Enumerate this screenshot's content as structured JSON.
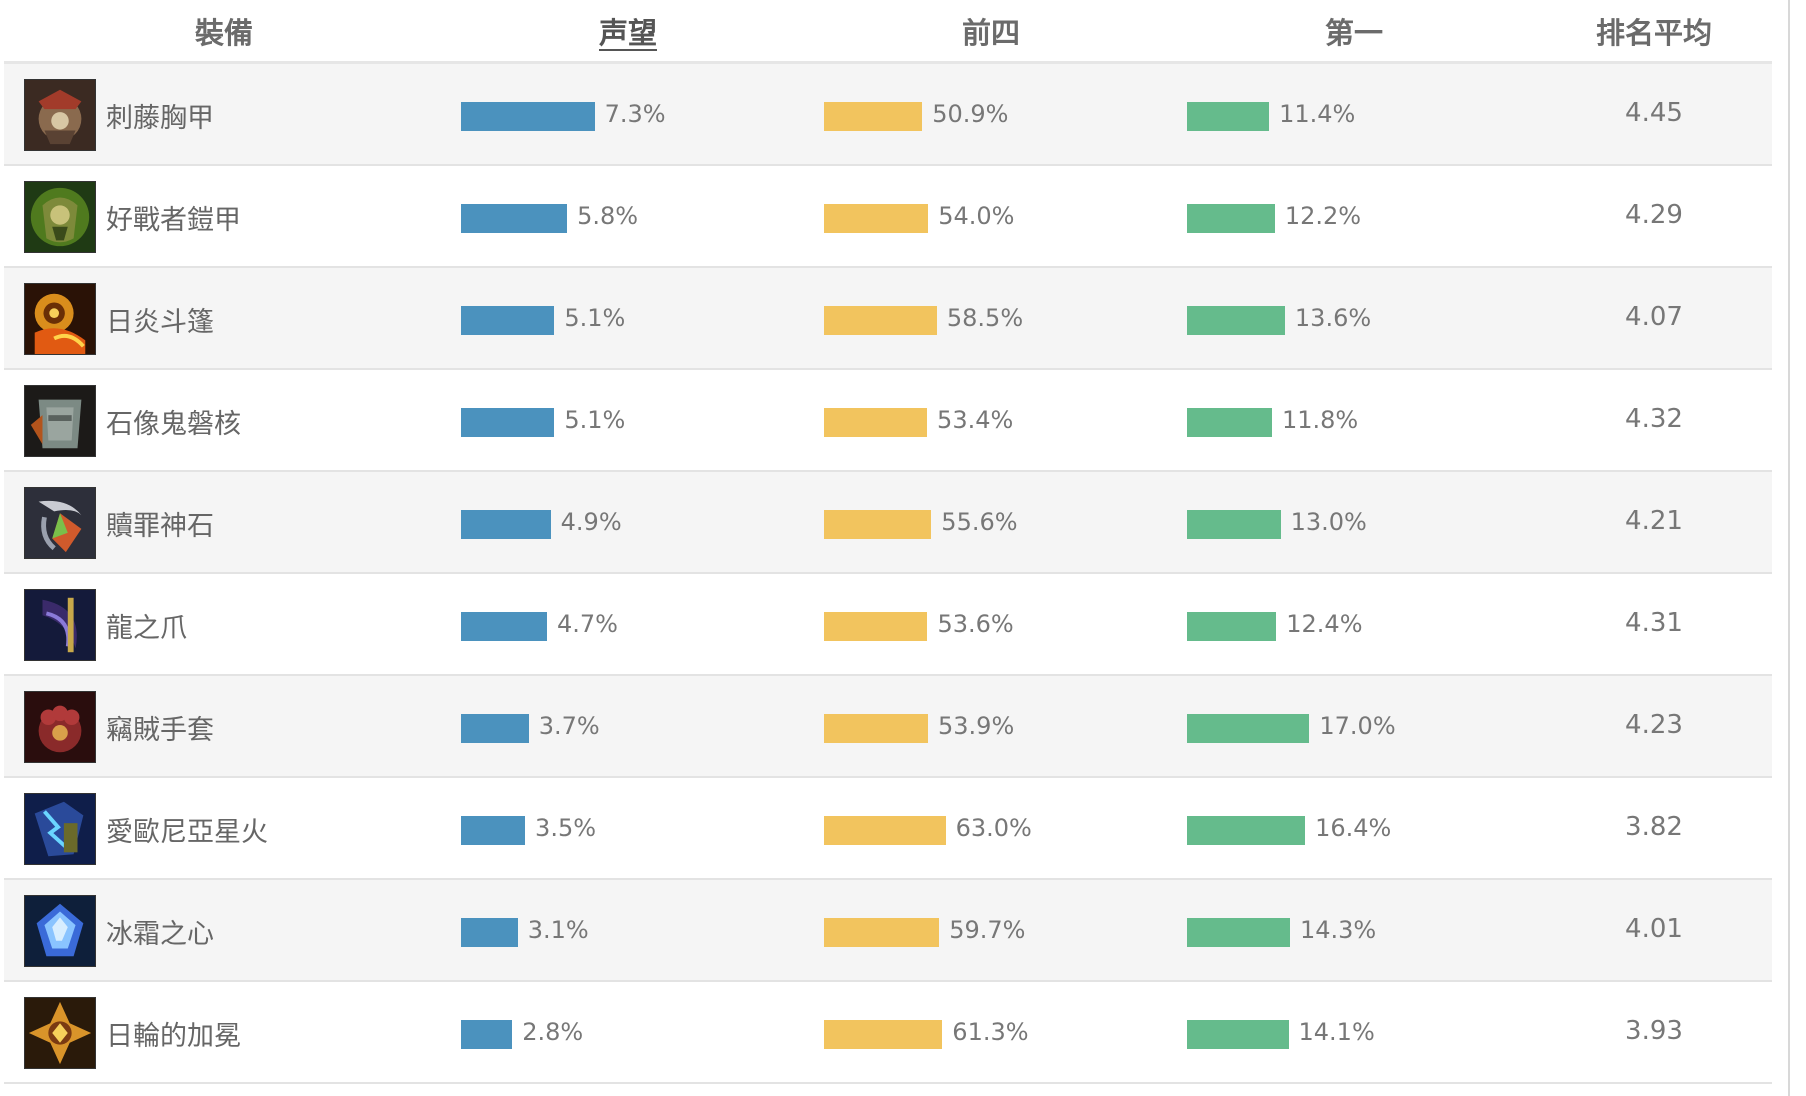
{
  "headers": {
    "item": "裝備",
    "reputation": "声望",
    "top4": "前四",
    "first": "第一",
    "avg_rank": "排名平均"
  },
  "colors": {
    "reputation_bar": "#4b92be",
    "top4_bar": "#f2c45e",
    "first_bar": "#65bb8c",
    "row_alt": "#f5f5f5"
  },
  "rows": [
    {
      "name": "刺藤胸甲",
      "icon": "thornmail-icon",
      "reputation": "7.3%",
      "reputation_value": 7.3,
      "top4": "50.9%",
      "top4_value": 50.9,
      "first": "11.4%",
      "first_value": 11.4,
      "avg": "4.45"
    },
    {
      "name": "好戰者鎧甲",
      "icon": "warmogs-armor-icon",
      "reputation": "5.8%",
      "reputation_value": 5.8,
      "top4": "54.0%",
      "top4_value": 54.0,
      "first": "12.2%",
      "first_value": 12.2,
      "avg": "4.29"
    },
    {
      "name": "日炎斗篷",
      "icon": "sunfire-cape-icon",
      "reputation": "5.1%",
      "reputation_value": 5.1,
      "top4": "58.5%",
      "top4_value": 58.5,
      "first": "13.6%",
      "first_value": 13.6,
      "avg": "4.07"
    },
    {
      "name": "石像鬼磐核",
      "icon": "gargoyle-stoneplate-icon",
      "reputation": "5.1%",
      "reputation_value": 5.1,
      "top4": "53.4%",
      "top4_value": 53.4,
      "first": "11.8%",
      "first_value": 11.8,
      "avg": "4.32"
    },
    {
      "name": "贖罪神石",
      "icon": "redemption-icon",
      "reputation": "4.9%",
      "reputation_value": 4.9,
      "top4": "55.6%",
      "top4_value": 55.6,
      "first": "13.0%",
      "first_value": 13.0,
      "avg": "4.21"
    },
    {
      "name": "龍之爪",
      "icon": "dragons-claw-icon",
      "reputation": "4.7%",
      "reputation_value": 4.7,
      "top4": "53.6%",
      "top4_value": 53.6,
      "first": "12.4%",
      "first_value": 12.4,
      "avg": "4.31"
    },
    {
      "name": "竊賊手套",
      "icon": "thiefs-gloves-icon",
      "reputation": "3.7%",
      "reputation_value": 3.7,
      "top4": "53.9%",
      "top4_value": 53.9,
      "first": "17.0%",
      "first_value": 17.0,
      "avg": "4.23"
    },
    {
      "name": "愛歐尼亞星火",
      "icon": "ionic-spark-icon",
      "reputation": "3.5%",
      "reputation_value": 3.5,
      "top4": "63.0%",
      "top4_value": 63.0,
      "first": "16.4%",
      "first_value": 16.4,
      "avg": "3.82"
    },
    {
      "name": "冰霜之心",
      "icon": "frozen-heart-icon",
      "reputation": "3.1%",
      "reputation_value": 3.1,
      "top4": "59.7%",
      "top4_value": 59.7,
      "first": "14.3%",
      "first_value": 14.3,
      "avg": "4.01"
    },
    {
      "name": "日輪的加冕",
      "icon": "locket-of-solari-icon",
      "reputation": "2.8%",
      "reputation_value": 2.8,
      "top4": "61.3%",
      "top4_value": 61.3,
      "first": "14.1%",
      "first_value": 14.1,
      "avg": "3.93"
    }
  ]
}
